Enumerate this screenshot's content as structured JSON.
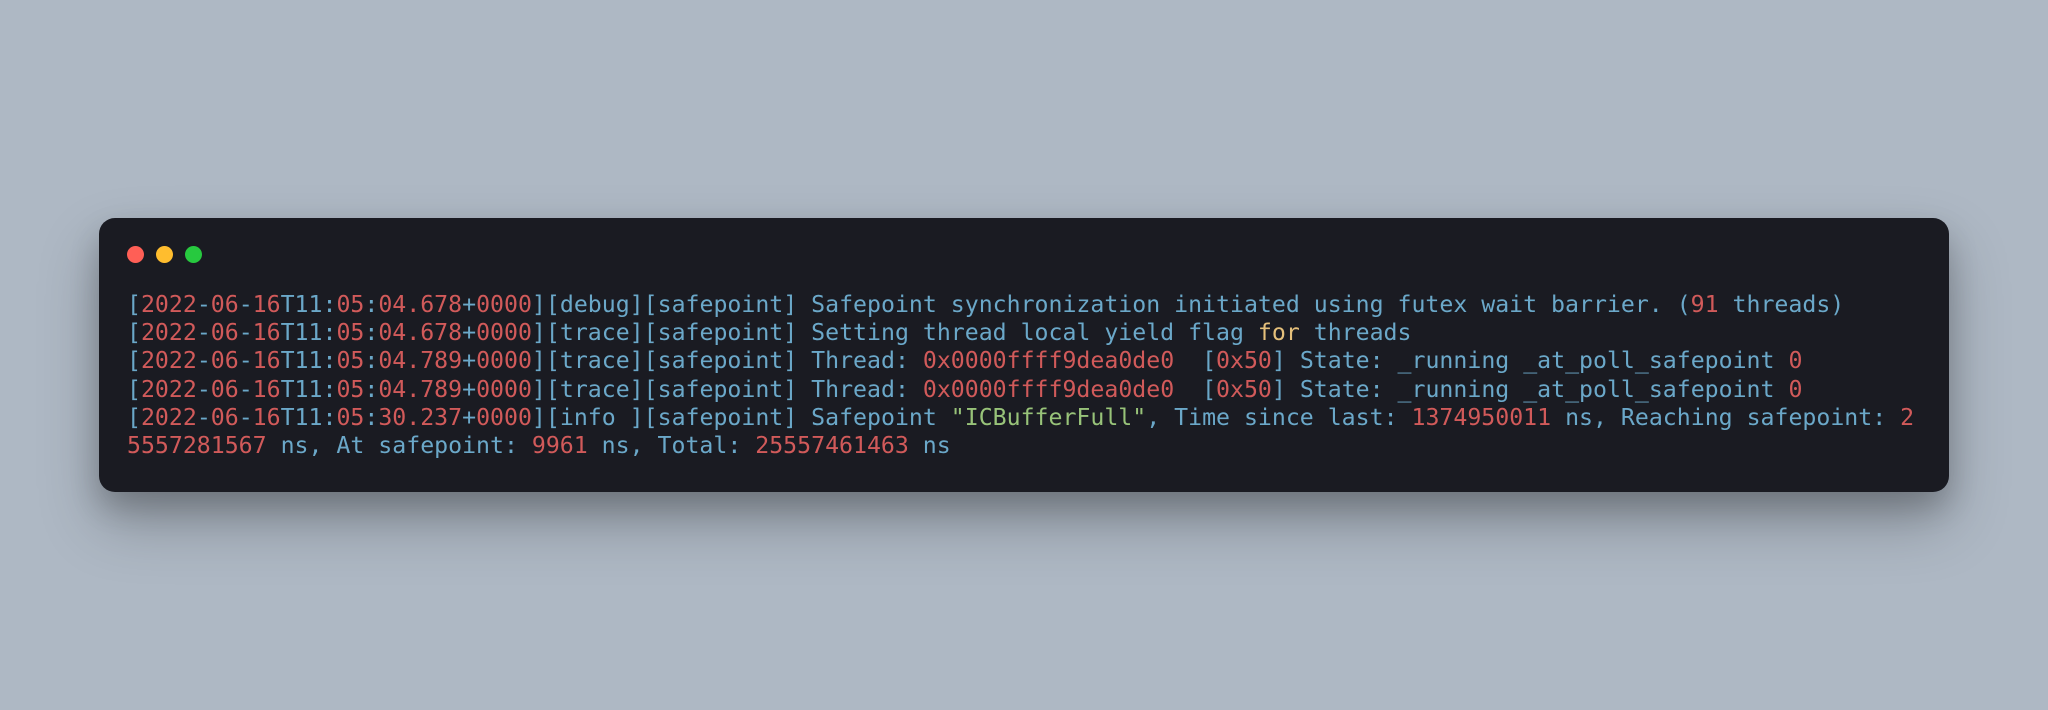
{
  "colors": {
    "background_page": "#aeb8c4",
    "background_terminal": "#1a1b22",
    "traffic_red": "#ff5f56",
    "traffic_yellow": "#ffbd2e",
    "traffic_green": "#27c93f",
    "text_default": "#6ba8c9",
    "text_number": "#d15a5a",
    "text_string": "#98c379",
    "text_keyword": "#e5c07b"
  },
  "log_lines": [
    {
      "timestamp": {
        "year": "2022",
        "mon": "06",
        "day": "16",
        "t": "T11",
        "min": "05",
        "sec": "04.678",
        "tz": "0000"
      },
      "level": "debug",
      "tag": "safepoint",
      "tokens": [
        {
          "t": "name",
          "v": " Safepoint synchronization initiated using futex wait barrier. "
        },
        {
          "t": "op",
          "v": "("
        },
        {
          "t": "num",
          "v": "91"
        },
        {
          "t": "name",
          "v": " threads"
        },
        {
          "t": "op",
          "v": ")"
        }
      ]
    },
    {
      "timestamp": {
        "year": "2022",
        "mon": "06",
        "day": "16",
        "t": "T11",
        "min": "05",
        "sec": "04.678",
        "tz": "0000"
      },
      "level": "trace",
      "tag": "safepoint",
      "tokens": [
        {
          "t": "name",
          "v": " Setting thread local yield flag "
        },
        {
          "t": "kw",
          "v": "for"
        },
        {
          "t": "name",
          "v": " threads"
        }
      ]
    },
    {
      "timestamp": {
        "year": "2022",
        "mon": "06",
        "day": "16",
        "t": "T11",
        "min": "05",
        "sec": "04.789",
        "tz": "0000"
      },
      "level": "trace",
      "tag": "safepoint",
      "tokens": [
        {
          "t": "name",
          "v": " Thread"
        },
        {
          "t": "op",
          "v": ": "
        },
        {
          "t": "num",
          "v": "0x0000ffff9dea0de0"
        },
        {
          "t": "name",
          "v": "  "
        },
        {
          "t": "op",
          "v": "["
        },
        {
          "t": "num",
          "v": "0x50"
        },
        {
          "t": "op",
          "v": "]"
        },
        {
          "t": "name",
          "v": " State"
        },
        {
          "t": "op",
          "v": ":"
        },
        {
          "t": "name",
          "v": " _running _at_poll_safepoint "
        },
        {
          "t": "num",
          "v": "0"
        }
      ]
    },
    {
      "timestamp": {
        "year": "2022",
        "mon": "06",
        "day": "16",
        "t": "T11",
        "min": "05",
        "sec": "04.789",
        "tz": "0000"
      },
      "level": "trace",
      "tag": "safepoint",
      "tokens": [
        {
          "t": "name",
          "v": " Thread"
        },
        {
          "t": "op",
          "v": ": "
        },
        {
          "t": "num",
          "v": "0x0000ffff9dea0de0"
        },
        {
          "t": "name",
          "v": "  "
        },
        {
          "t": "op",
          "v": "["
        },
        {
          "t": "num",
          "v": "0x50"
        },
        {
          "t": "op",
          "v": "]"
        },
        {
          "t": "name",
          "v": " State"
        },
        {
          "t": "op",
          "v": ":"
        },
        {
          "t": "name",
          "v": " _running _at_poll_safepoint "
        },
        {
          "t": "num",
          "v": "0"
        }
      ]
    },
    {
      "timestamp": {
        "year": "2022",
        "mon": "06",
        "day": "16",
        "t": "T11",
        "min": "05",
        "sec": "30.237",
        "tz": "0000"
      },
      "level": "info ",
      "tag": "safepoint",
      "tokens": [
        {
          "t": "name",
          "v": " Safepoint "
        },
        {
          "t": "str",
          "v": "\"ICBufferFull\""
        },
        {
          "t": "op",
          "v": ","
        },
        {
          "t": "name",
          "v": " Time since last"
        },
        {
          "t": "op",
          "v": ": "
        },
        {
          "t": "num",
          "v": "1374950011"
        },
        {
          "t": "name",
          "v": " ns"
        },
        {
          "t": "op",
          "v": ","
        },
        {
          "t": "name",
          "v": " Reaching safepoint"
        },
        {
          "t": "op",
          "v": ": "
        },
        {
          "t": "num",
          "v": "25557281567"
        },
        {
          "t": "name",
          "v": " ns"
        },
        {
          "t": "op",
          "v": ","
        },
        {
          "t": "name",
          "v": " At safepoint"
        },
        {
          "t": "op",
          "v": ": "
        },
        {
          "t": "num",
          "v": "9961"
        },
        {
          "t": "name",
          "v": " ns"
        },
        {
          "t": "op",
          "v": ","
        },
        {
          "t": "name",
          "v": " Total"
        },
        {
          "t": "op",
          "v": ": "
        },
        {
          "t": "num",
          "v": "25557461463"
        },
        {
          "t": "name",
          "v": " ns"
        }
      ]
    }
  ]
}
